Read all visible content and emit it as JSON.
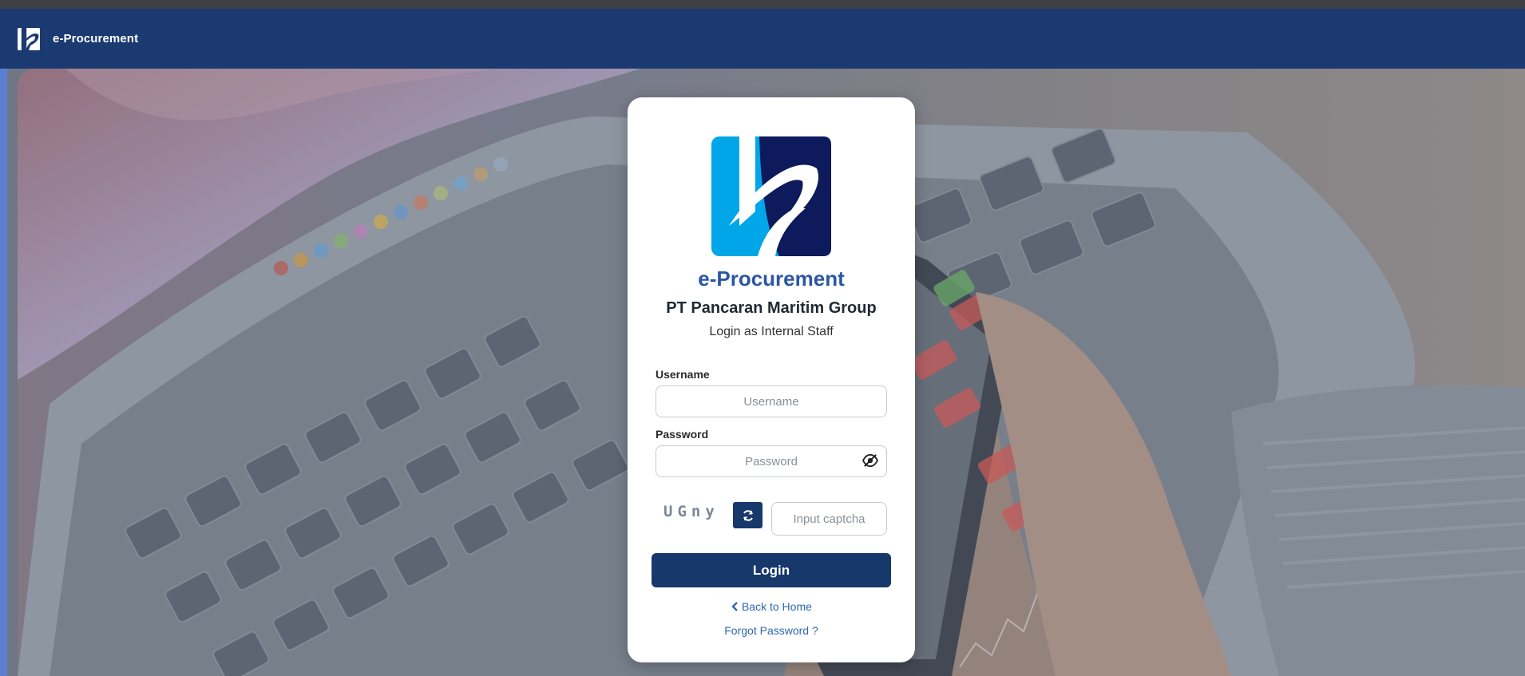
{
  "header": {
    "title": "e-Procurement",
    "logo_icon": "pancaran-logo-icon"
  },
  "login": {
    "brand_title": "e-Procurement",
    "company": "PT Pancaran Maritim Group",
    "subtitle": "Login as Internal Staff",
    "username_label": "Username",
    "username_placeholder": "Username",
    "username_value": "",
    "password_label": "Password",
    "password_placeholder": "Password",
    "password_value": "",
    "captcha_text": "UGny",
    "captcha_placeholder": "Input captcha",
    "captcha_value": "",
    "login_button": "Login",
    "back_link": "Back to Home",
    "forgot_link": "Forgot Password ?"
  },
  "icons": {
    "visibility_toggle": "eye-slash-icon",
    "refresh": "refresh-icon",
    "back": "chevron-left-icon"
  },
  "colors": {
    "header_bg": "#1b3a72",
    "primary_button": "#17386b",
    "brand_title": "#2a56a6",
    "link": "#2f68b0",
    "logo_light_blue": "#00a6e8",
    "logo_navy": "#0d1a5c"
  }
}
